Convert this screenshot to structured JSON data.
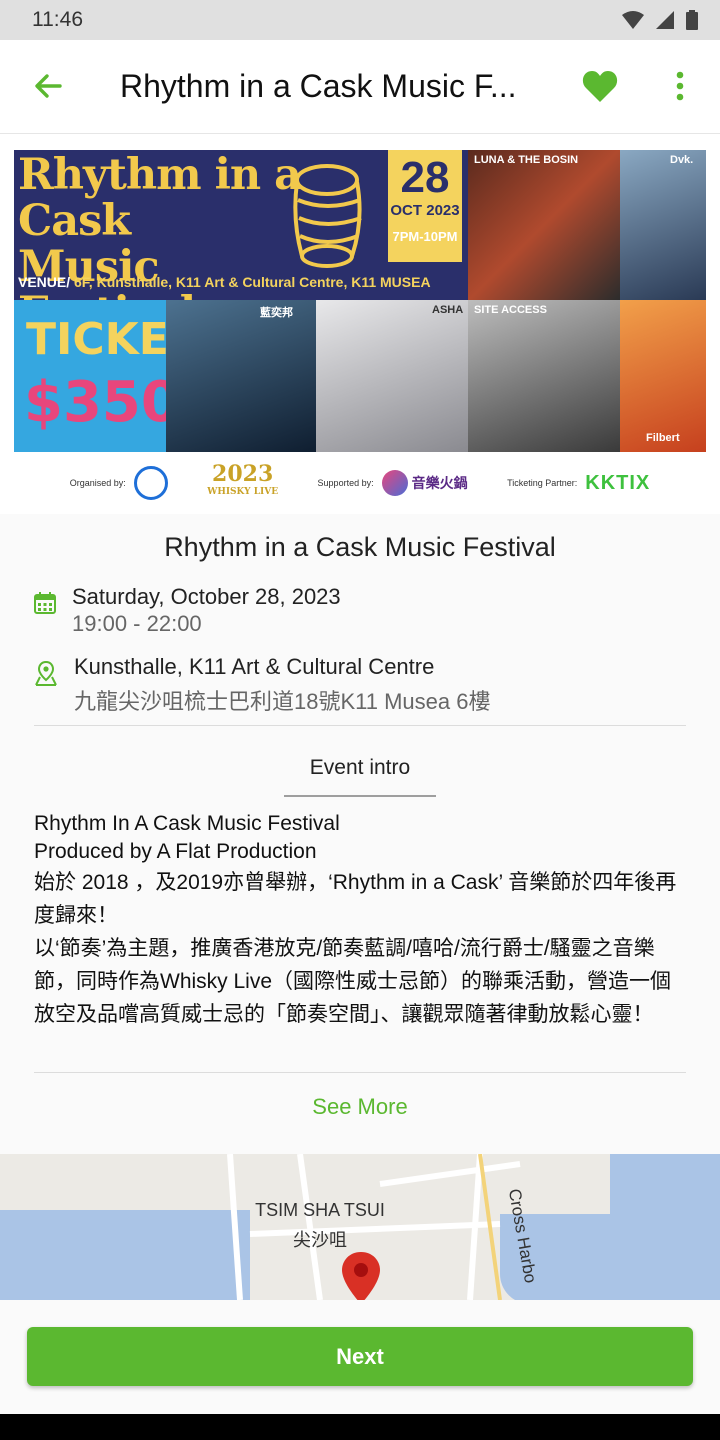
{
  "status_bar": {
    "time": "11:46"
  },
  "app_bar": {
    "title": "Rhythm in a Cask Music F..."
  },
  "poster": {
    "title_line1": "Rhythm in a Cask",
    "title_line2": "Music Festival",
    "date_day": "28",
    "date_month": "OCT 2023",
    "date_time": "7PM-10PM",
    "venue_label": "VENUE/",
    "venue_value": "6F, Kunsthalle, K11 Art & Cultural Centre, K11 MUSEA",
    "ticket_label": "TICKET",
    "ticket_price": "$350",
    "photo_captions": [
      "LUNA & THE BOSIN",
      "Dvk.",
      "藍奕邦",
      "ASHA",
      "SITE ACCESS",
      "Filbert"
    ],
    "organised_by_label": "Organised by:",
    "supported_by_label": "Supported by:",
    "ticketing_partner_label": "Ticketing Partner:",
    "whisky_logo_year": "2023",
    "whisky_logo_text": "WHISKY LIVE",
    "music_logo_text": "音樂火鍋",
    "kktix_logo_text": "KKTIX"
  },
  "event": {
    "title": "Rhythm in a Cask Music Festival",
    "date": "Saturday, October 28, 2023",
    "time": "19:00 - 22:00",
    "venue_name": "Kunsthalle, K11 Art & Cultural Centre",
    "venue_address": "九龍尖沙咀梳士巴利道18號K11 Musea 6樓"
  },
  "tab": {
    "label": "Event intro"
  },
  "intro": {
    "line1": "Rhythm In A Cask Music Festival",
    "line2": "Produced by A Flat Production",
    "paragraph_zh_1": "始於 2018 ，及2019亦曾舉辦，‘Rhythm in a Cask’ 音樂節於四年後再度歸來！",
    "paragraph_zh_2": "以‘節奏’為主題，推廣香港放克/節奏藍調/嘻哈/流行爵士/騷靈之音樂節，同時作為Whisky Live（國際性威士忌節）的聯乘活動，營造一個放空及品嚐高質威士忌的「節奏空間」、讓觀眾隨著律動放鬆心靈！"
  },
  "see_more": "See More",
  "map": {
    "district_en": "TSIM SHA TSUI",
    "district_zh": "尖沙咀",
    "road_label": "Cross Harbo"
  },
  "next_button": "Next",
  "colors": {
    "accent": "#5bb830",
    "poster_bg": "#2a2f6b",
    "poster_gold": "#f2c94c"
  }
}
